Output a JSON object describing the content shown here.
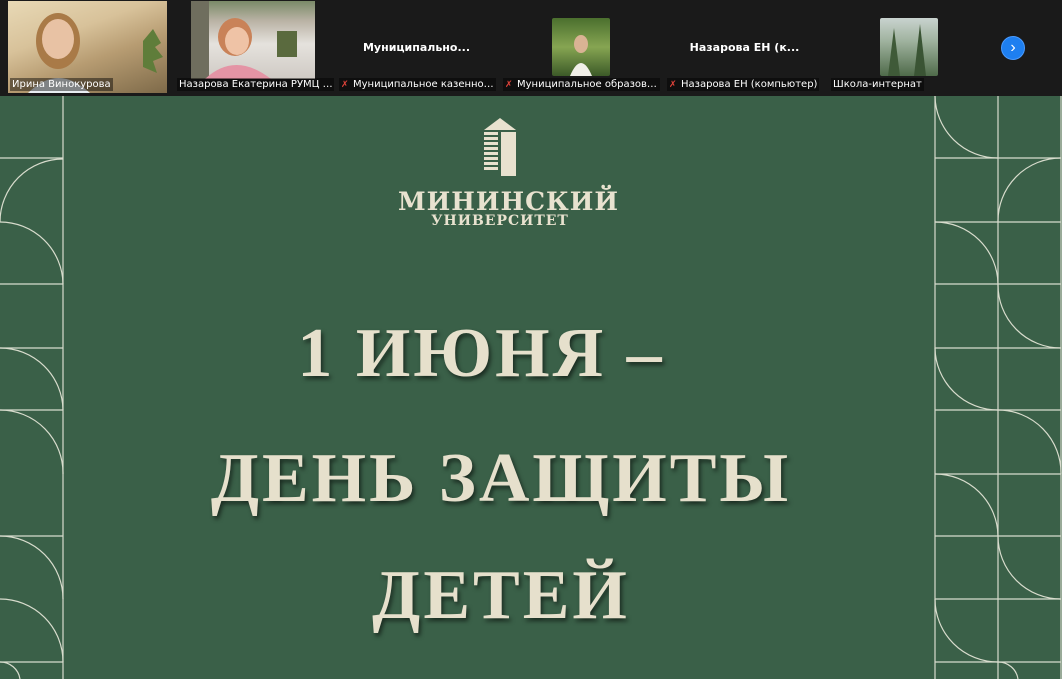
{
  "participants": [
    {
      "name": "Ирина Винокурова",
      "muted": false,
      "active": true
    },
    {
      "name": "Назарова Екатерина РУМЦ Минин...",
      "muted": false
    },
    {
      "name": "Муниципальное казенное обра...",
      "muted": true,
      "display": "Муниципально..."
    },
    {
      "name": "Муниципальное образователь...",
      "muted": true
    },
    {
      "name": "Назарова ЕН (компьютер)",
      "muted": true,
      "display": "Назарова ЕН (к..."
    },
    {
      "name": "Школа-интернат",
      "muted": false
    }
  ],
  "next_icon": "chevron-right-icon",
  "slide": {
    "logo_line1": "МИНИНСКИЙ",
    "logo_line2": "УНИВЕРСИТЕТ",
    "title_line1": "1 ИЮНЯ –",
    "title_line2": "ДЕНЬ ЗАЩИТЫ",
    "title_line3": "ДЕТЕЙ",
    "background_color": "#3a6048",
    "text_color": "#e6e0cc"
  }
}
